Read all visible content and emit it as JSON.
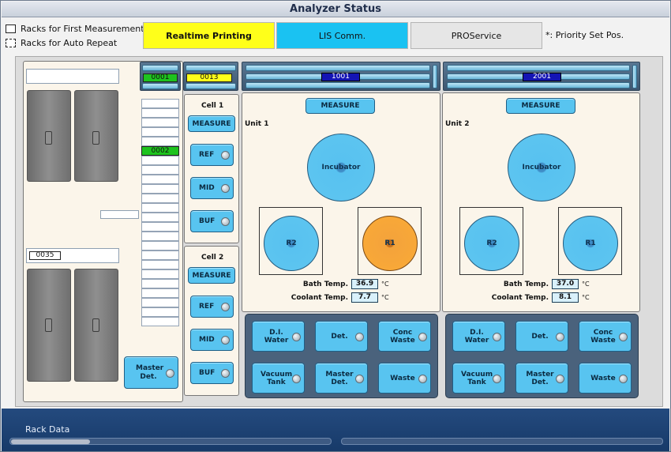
{
  "window": {
    "title": "Analyzer Status"
  },
  "legend": {
    "first": "Racks for First Measurement",
    "auto": "Racks for Auto Repeat"
  },
  "status_buttons": [
    {
      "label": "Realtime Printing",
      "color": "#ffff1a"
    },
    {
      "label": "LIS Comm.",
      "color": "#1ac2f2"
    },
    {
      "label": "PROService",
      "color": "#e6e6e6"
    }
  ],
  "priority_note": "*: Priority Set Pos.",
  "left": {
    "rack_top_id": "",
    "rack_bottom_id": "0035",
    "mid_field": "",
    "master_det": "Master Det."
  },
  "sampler": {
    "header_id": "0001",
    "tube_id": "0002"
  },
  "cells": {
    "header_id": "0013",
    "cell1": {
      "title": "Cell 1",
      "measure": "MEASURE",
      "buttons": [
        "REF",
        "MID",
        "BUF"
      ]
    },
    "cell2": {
      "title": "Cell 2",
      "measure": "MEASURE",
      "buttons": [
        "REF",
        "MID",
        "BUF"
      ]
    }
  },
  "units": [
    {
      "header_id": "1001",
      "name": "Unit 1",
      "measure": "MEASURE",
      "incubator": "Incubator",
      "r2": "R2",
      "r1": "R1",
      "r1_color": "orange",
      "bath_label": "Bath Temp.",
      "bath_value": "36.9",
      "coolant_label": "Coolant Temp.",
      "coolant_value": "7.7",
      "unit": "°C",
      "reagents": [
        "D.I. Water",
        "Det.",
        "Conc Waste",
        "Vacuum Tank",
        "Master Det.",
        "Waste"
      ]
    },
    {
      "header_id": "2001",
      "name": "Unit 2",
      "measure": "MEASURE",
      "incubator": "Incubator",
      "r2": "R2",
      "r1": "R1",
      "r1_color": "blue",
      "bath_label": "Bath Temp.",
      "bath_value": "37.0",
      "coolant_label": "Coolant Temp.",
      "coolant_value": "8.1",
      "unit": "°C",
      "reagents": [
        "D.I. Water",
        "Det.",
        "Conc Waste",
        "Vacuum Tank",
        "Master Det.",
        "Waste"
      ]
    }
  ],
  "bottom": {
    "title": "Rack Data"
  }
}
